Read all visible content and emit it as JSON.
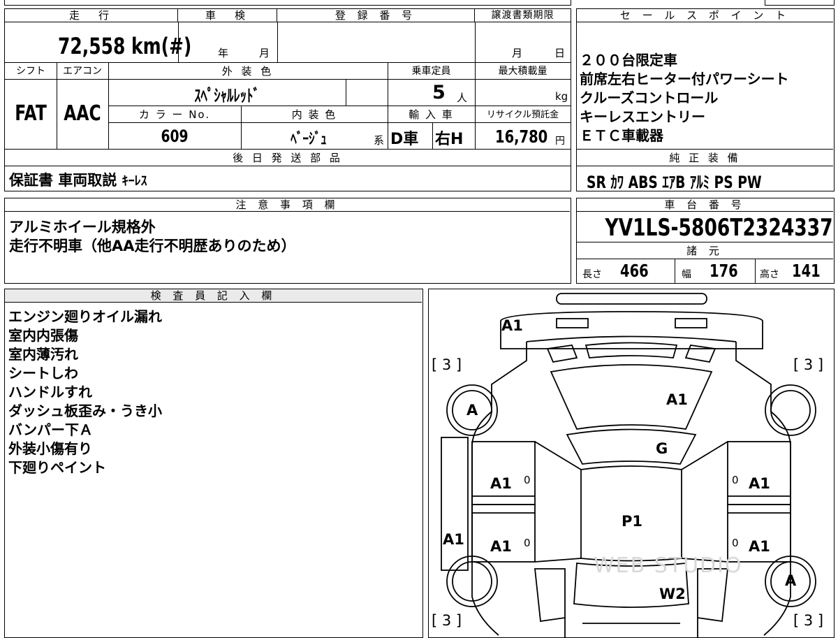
{
  "vehicle": {
    "mileage_header": "走　行",
    "mileage_value": "72,558 km(#)",
    "inspection_header": "車　検",
    "inspection_year_unit": "年",
    "inspection_month_unit": "月",
    "registration_header": "登 録 番 号",
    "transfer_deadline_header": "譲渡書類期限",
    "transfer_month_unit": "月",
    "transfer_day_unit": "日",
    "shift_header": "シフト",
    "shift_value": "FAT",
    "aircon_header": "エアコン",
    "aircon_value": "AAC",
    "exterior_color_header": "外 装 色",
    "exterior_color_value": "ｽﾍﾟｼｬﾙﾚｯﾄﾞ",
    "capacity_header": "乗車定員",
    "capacity_value": "5",
    "capacity_unit": "人",
    "max_load_header": "最大積載量",
    "max_load_unit": "kg",
    "color_no_header": "カ ラ ー No.",
    "color_no_value": "609",
    "interior_color_header": "内 装 色",
    "interior_color_value": "ﾍﾞｰｼﾞｭ",
    "interior_color_suffix": "系",
    "import_header": "輸 入 車",
    "import_value": "D車",
    "handle_value": "右H",
    "recycle_header": "リサイクル預託金",
    "recycle_value": "16,780",
    "recycle_unit": "円"
  },
  "sales_points": {
    "header": "セ ー ル ス ポ イ ン ト",
    "items": [
      "２００台限定車",
      "前席左右ヒーター付パワーシート",
      "クルーズコントロール",
      "キーレスエントリー",
      "ＥＴＣ車載器"
    ]
  },
  "later_parts": {
    "header": "後 日 発 送 部 品",
    "value_main": "保証書 車両取説",
    "value_kana": "ｷｰﾚｽ"
  },
  "genuine_equipment": {
    "header": "純 正 装 備",
    "value": "SR ｶﾜ ABS ｴｱB ｱﾙﾐ PS PW"
  },
  "notes": {
    "header": "注 意 事 項 欄",
    "lines": [
      "アルミホイール規格外",
      "走行不明車（他AA走行不明歴ありのため）"
    ]
  },
  "chassis": {
    "header": "車 台 番 号",
    "value": "YV1LS-5806T2324337"
  },
  "specs": {
    "header": "諸 元",
    "length_label": "長さ",
    "length_value": "466",
    "width_label": "幅",
    "width_value": "176",
    "height_label": "高さ",
    "height_value": "141"
  },
  "inspector": {
    "header": "検 査 員 記 入 欄",
    "lines": [
      "エンジン廻りオイル漏れ",
      "室内内張傷",
      "室内薄汚れ",
      "シートしわ",
      "ハンドルすれ",
      "ダッシュ板歪み・うき小",
      "バンパー下Ａ",
      "外装小傷有り",
      "下廻りペイント"
    ]
  },
  "diagram": {
    "marks": {
      "front_bumper": "A1",
      "hood": "A1",
      "windshield": "G",
      "left_front_door": "A1",
      "right_front_door": "A1",
      "left_rear_door": "A1",
      "right_rear_door": "A1",
      "roof": "P1",
      "left_sill": "A1",
      "rear_glass": "W2",
      "front_left_wheel": "A",
      "rear_right_wheel": "A"
    },
    "tire_front_left": "[ 3 ]",
    "tire_front_right": "[ 3 ]",
    "tire_rear_left": "[ 3 ]",
    "tire_rear_right": "[ 3 ]",
    "zero_marks": [
      "0",
      "0",
      "0",
      "0"
    ],
    "watermark": "WEB STUDIO"
  }
}
